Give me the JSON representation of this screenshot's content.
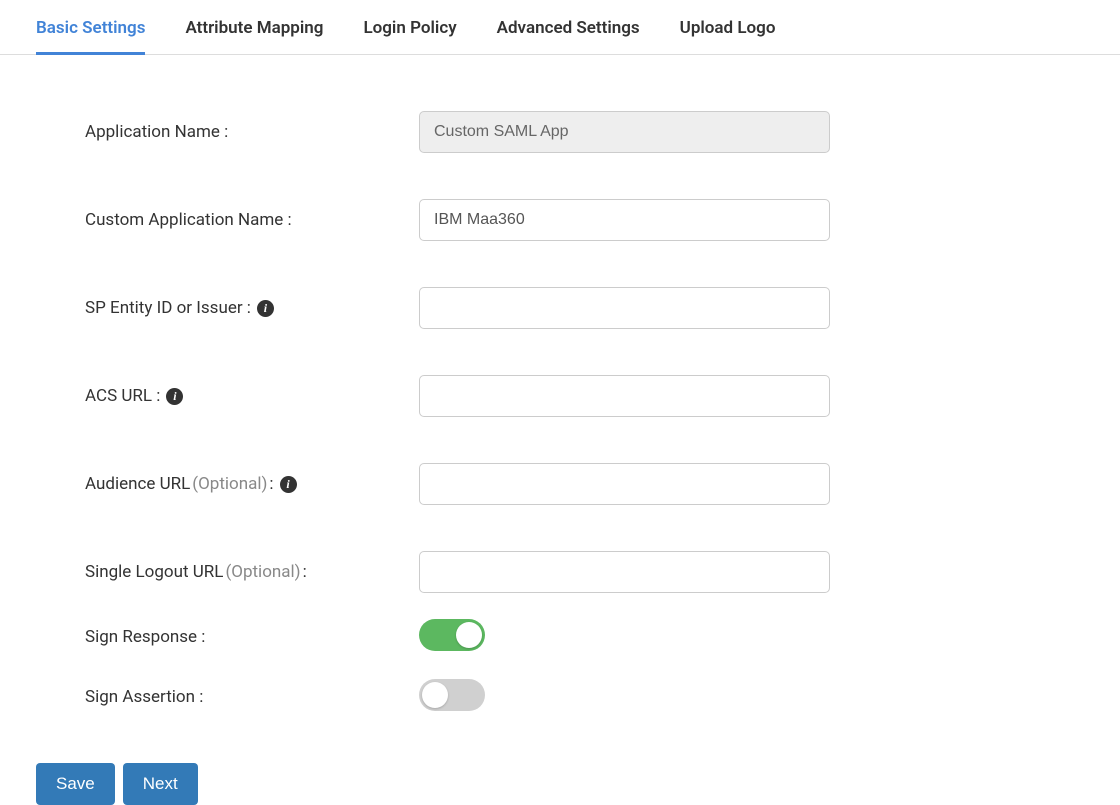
{
  "tabs": {
    "basic": "Basic Settings",
    "attr": "Attribute Mapping",
    "login": "Login Policy",
    "adv": "Advanced Settings",
    "logo": "Upload Logo"
  },
  "labels": {
    "app_name": "Application Name :",
    "custom_app_name": "Custom Application Name :",
    "sp_entity": "SP Entity ID or Issuer :",
    "acs_url": "ACS URL :",
    "audience_url_prefix": "Audience URL ",
    "audience_url_suffix": " :",
    "slo_prefix": "Single Logout URL ",
    "slo_suffix": " :",
    "optional": "(Optional)",
    "sign_response": "Sign Response :",
    "sign_assertion": "Sign Assertion :"
  },
  "values": {
    "app_name": "Custom SAML App",
    "custom_app_name": "IBM Maa360",
    "sp_entity": "",
    "acs_url": "",
    "audience_url": "",
    "slo_url": ""
  },
  "toggles": {
    "sign_response": true,
    "sign_assertion": false
  },
  "buttons": {
    "save": "Save",
    "next": "Next"
  },
  "info_glyph": "i"
}
